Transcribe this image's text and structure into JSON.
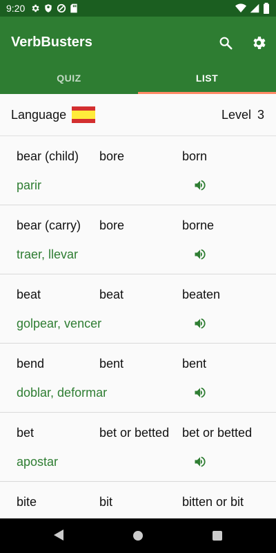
{
  "status_bar": {
    "time": "9:20"
  },
  "app_bar": {
    "title": "VerbBusters",
    "tabs": [
      {
        "label": "QUIZ",
        "active": false
      },
      {
        "label": "LIST",
        "active": true
      }
    ]
  },
  "language_row": {
    "label": "Language",
    "flag": "spain",
    "level_label": "Level",
    "level_value": "3"
  },
  "verbs": [
    {
      "base": "bear (child)",
      "past": "bore",
      "participle": "born",
      "translation": "parir"
    },
    {
      "base": "bear (carry)",
      "past": "bore",
      "participle": "borne",
      "translation": "traer, llevar"
    },
    {
      "base": "beat",
      "past": "beat",
      "participle": "beaten",
      "translation": "golpear, vencer"
    },
    {
      "base": "bend",
      "past": "bent",
      "participle": "bent",
      "translation": "doblar, deformar"
    },
    {
      "base": "bet",
      "past": "bet or betted",
      "participle": "bet or betted",
      "translation": "apostar"
    },
    {
      "base": "bite",
      "past": "bit",
      "participle": "bitten or bit",
      "translation": ""
    }
  ],
  "colors": {
    "primary": "#2e7d32",
    "primary_dark": "#1b5e20",
    "tab_indicator": "#ff8a65",
    "translation": "#2e7d32"
  }
}
